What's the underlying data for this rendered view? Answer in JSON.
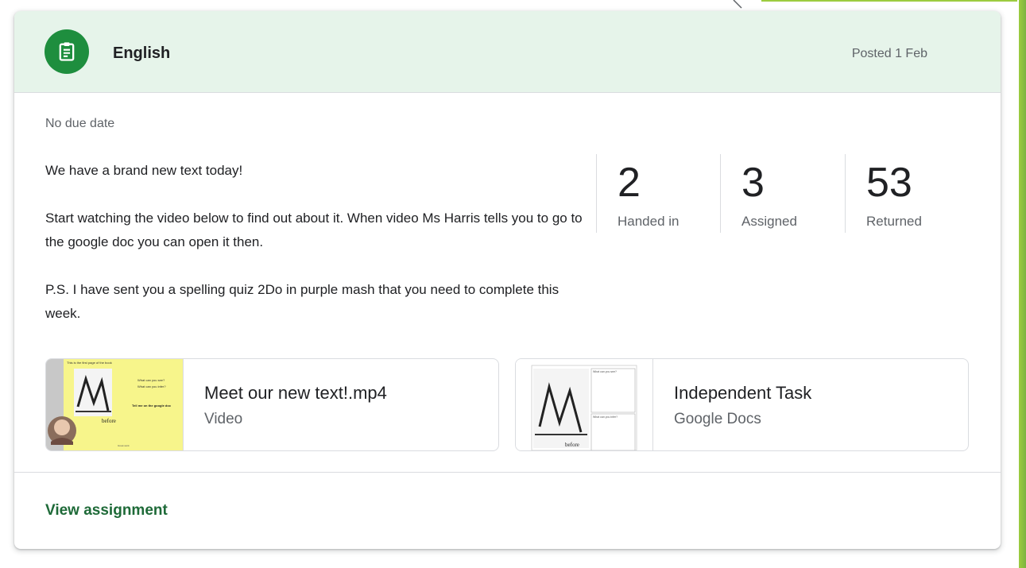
{
  "header": {
    "subject": "English",
    "posted": "Posted 1 Feb",
    "icon": "assignment-icon",
    "accent": "#1e8e3e",
    "header_bg": "#e6f4ea"
  },
  "due": "No due date",
  "description": {
    "p1": "We have a brand new text today!",
    "p2": "Start watching the video below to find out about it. When video Ms Harris tells you to go to the google doc you can open it then.",
    "p3": "P.S. I have sent you a spelling quiz 2Do in purple mash that you need to complete this week."
  },
  "stats": [
    {
      "value": "2",
      "label": "Handed in"
    },
    {
      "value": "3",
      "label": "Assigned"
    },
    {
      "value": "53",
      "label": "Returned"
    }
  ],
  "attachments": [
    {
      "title": "Meet our new text!.mp4",
      "type": "Video",
      "thumb": {
        "heading": "This is the first page of the book",
        "q1": "What can you see?",
        "q2": "What can you infer?",
        "prompt": "Tell me on the google doc",
        "caption": "before",
        "footer": "Great work"
      }
    },
    {
      "title": "Independent Task",
      "type": "Google Docs",
      "thumb": {
        "box1": "What can you see?",
        "box2": "What can you infer?",
        "caption": "before"
      }
    }
  ],
  "footer": {
    "view_label": "View assignment",
    "link_color": "#1e6a38"
  }
}
